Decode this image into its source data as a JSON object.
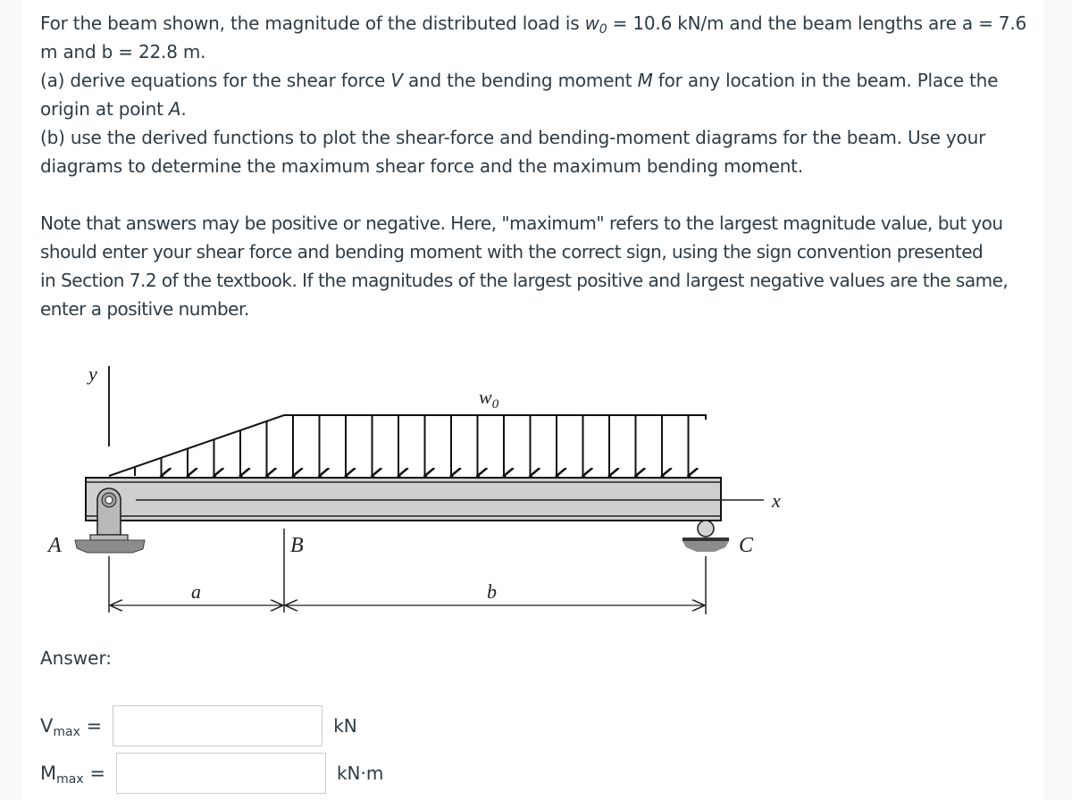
{
  "question": {
    "intro_prefix": "For the beam shown, the magnitude of the distributed load is ",
    "w_symbol": "w",
    "w_subscript": "0",
    "intro_suffix_1": " = 10.6 kN/m and the beam lengths are a = 7.6",
    "intro_line2": "m and b = 22.8 m.",
    "part_a_prefix": "(a) derive equations for the shear force ",
    "part_a_V": "V",
    "part_a_mid": " and the bending moment ",
    "part_a_M": "M",
    "part_a_suffix": " for any location in the beam.  Place the",
    "part_a_line2_prefix": "origin at point ",
    "part_a_A": "A",
    "part_a_line2_suffix": ".",
    "part_b_line1": "(b) use the derived functions to plot the shear-force and bending-moment diagrams for the beam.  Use your",
    "part_b_line2": "diagrams to determine the maximum shear force and the maximum bending moment.",
    "note_line1": "Note that answers may be positive or negative. Here, \"maximum\" refers to the largest magnitude value, but you",
    "note_line2": "should enter your shear force and bending moment with the correct sign, using the sign convention presented",
    "note_line3": "in Section 7.2 of the textbook. If the magnitudes of the largest positive and largest negative values are the same,",
    "note_line4": "enter a positive number."
  },
  "given": {
    "w0": "10.6 kN/m",
    "a": "7.6 m",
    "b": "22.8 m"
  },
  "diagram": {
    "label_y": "y",
    "label_x": "x",
    "label_A": "A",
    "label_B": "B",
    "label_C": "C",
    "label_a": "a",
    "label_b": "b",
    "label_w": "w",
    "label_w_sub": "0",
    "support_A": "pin-support",
    "support_C": "roller-support",
    "load": "linearly increasing from 0 at A to w0 at B, then uniform w0 from B to C"
  },
  "answer": {
    "heading": "Answer:",
    "vmax": {
      "symbol": "V",
      "subscript": "max",
      "equals": "=",
      "value": "",
      "placeholder": "",
      "unit": "kN"
    },
    "mmax": {
      "symbol": "M",
      "subscript": "max",
      "equals": "=",
      "value": "",
      "placeholder": "",
      "unit": "kN·m"
    }
  }
}
